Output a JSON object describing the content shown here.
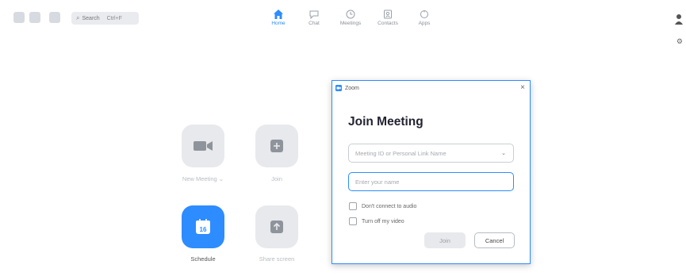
{
  "toolbar": {
    "search_label": "Search",
    "search_shortcut": "Ctrl+F",
    "nav": [
      {
        "label": "Home",
        "icon": "home-icon",
        "active": true
      },
      {
        "label": "Chat",
        "icon": "chat-icon",
        "active": false
      },
      {
        "label": "Meetings",
        "icon": "clock-icon",
        "active": false
      },
      {
        "label": "Contacts",
        "icon": "contacts-icon",
        "active": false
      },
      {
        "label": "Apps",
        "icon": "apps-icon",
        "active": false
      }
    ]
  },
  "home": {
    "tiles": [
      {
        "label": "New Meeting ⌄",
        "icon": "video-camera-icon"
      },
      {
        "label": "Join",
        "icon": "plus-icon"
      },
      {
        "label": "Schedule",
        "icon": "calendar-icon"
      },
      {
        "label": "Share screen",
        "icon": "share-screen-icon"
      }
    ],
    "calendar_day": "16"
  },
  "dialog": {
    "window_title": "Zoom",
    "heading": "Join Meeting",
    "meeting_id_placeholder": "Meeting ID or Personal Link Name",
    "name_placeholder": "Enter your name",
    "option_audio": "Don't connect to audio",
    "option_video": "Turn off my video",
    "join_label": "Join",
    "cancel_label": "Cancel"
  },
  "colors": {
    "accent": "#2d8cff",
    "tile_bg": "#e8e9ec",
    "disabled_text": "#9aa0a6"
  }
}
